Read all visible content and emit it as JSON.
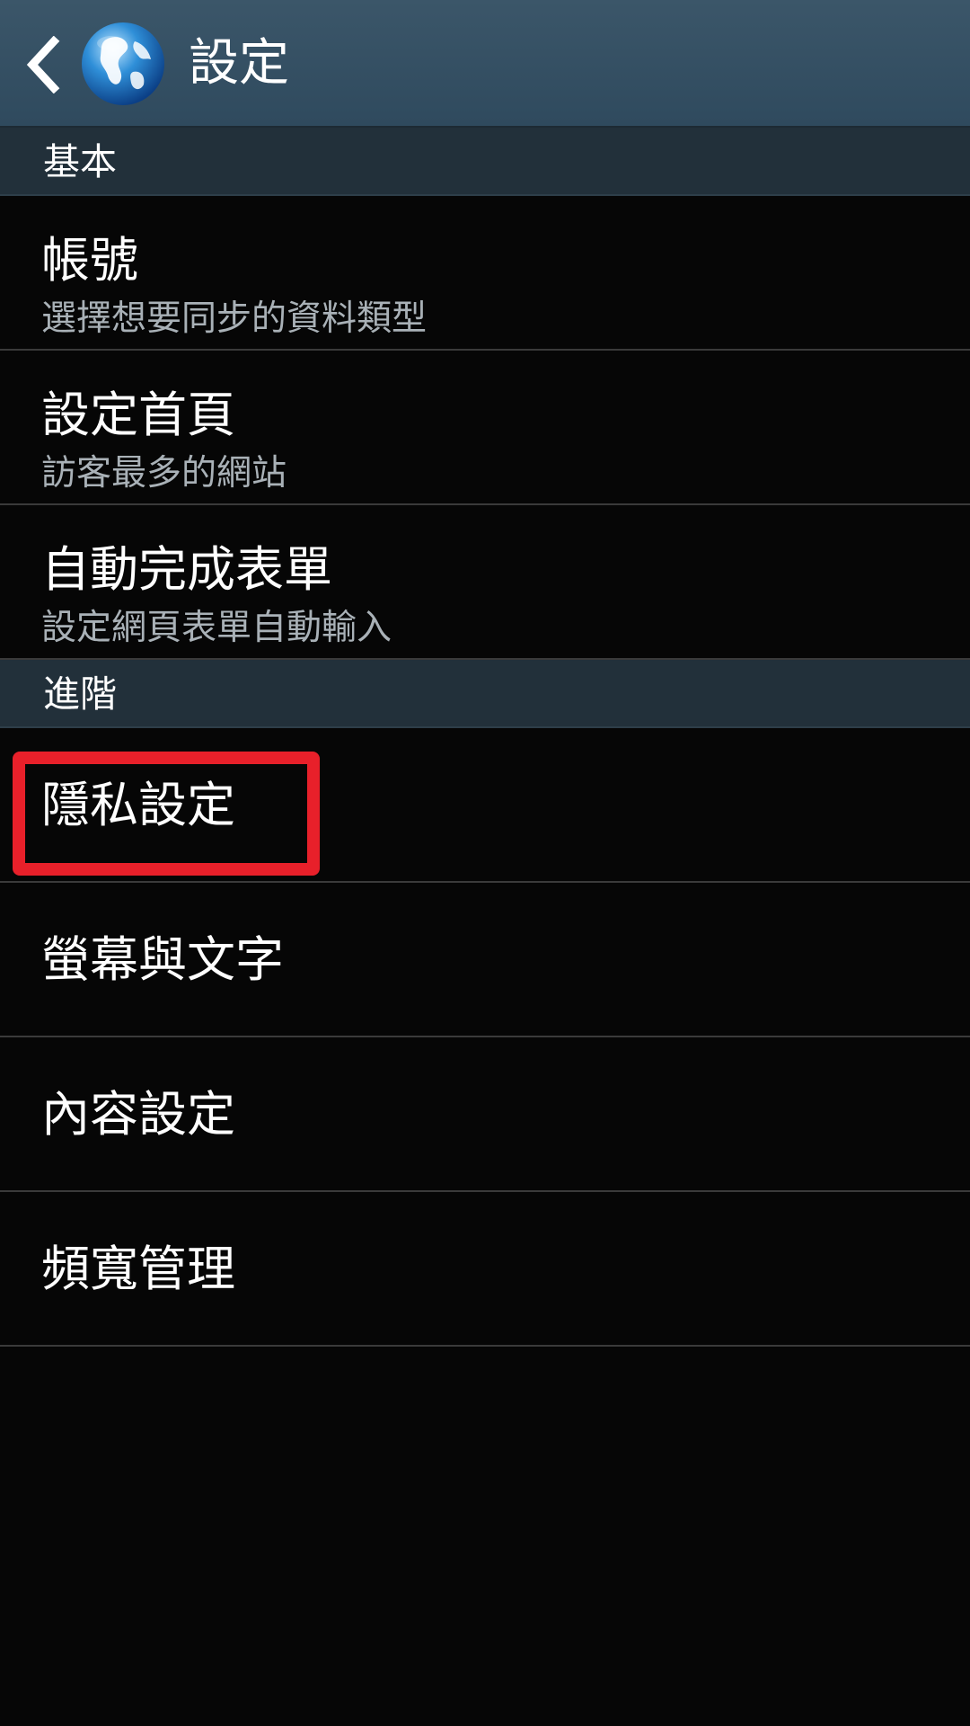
{
  "action_bar": {
    "title": "設定",
    "back_icon": "chevron-left-icon",
    "app_icon": "globe-icon"
  },
  "sections": [
    {
      "header": "基本",
      "items": [
        {
          "title": "帳號",
          "summary": "選擇想要同步的資料類型"
        },
        {
          "title": "設定首頁",
          "summary": "訪客最多的網站"
        },
        {
          "title": "自動完成表單",
          "summary": "設定網頁表單自動輸入"
        }
      ]
    },
    {
      "header": "進階",
      "items": [
        {
          "title": "隱私設定"
        },
        {
          "title": "螢幕與文字"
        },
        {
          "title": "內容設定"
        },
        {
          "title": "頻寬管理"
        }
      ]
    }
  ],
  "colors": {
    "action_bar": "#34506a",
    "section_header": "#22303a",
    "background": "#060606",
    "summary_text": "#a9b1b7",
    "highlight": "#e8202a"
  }
}
